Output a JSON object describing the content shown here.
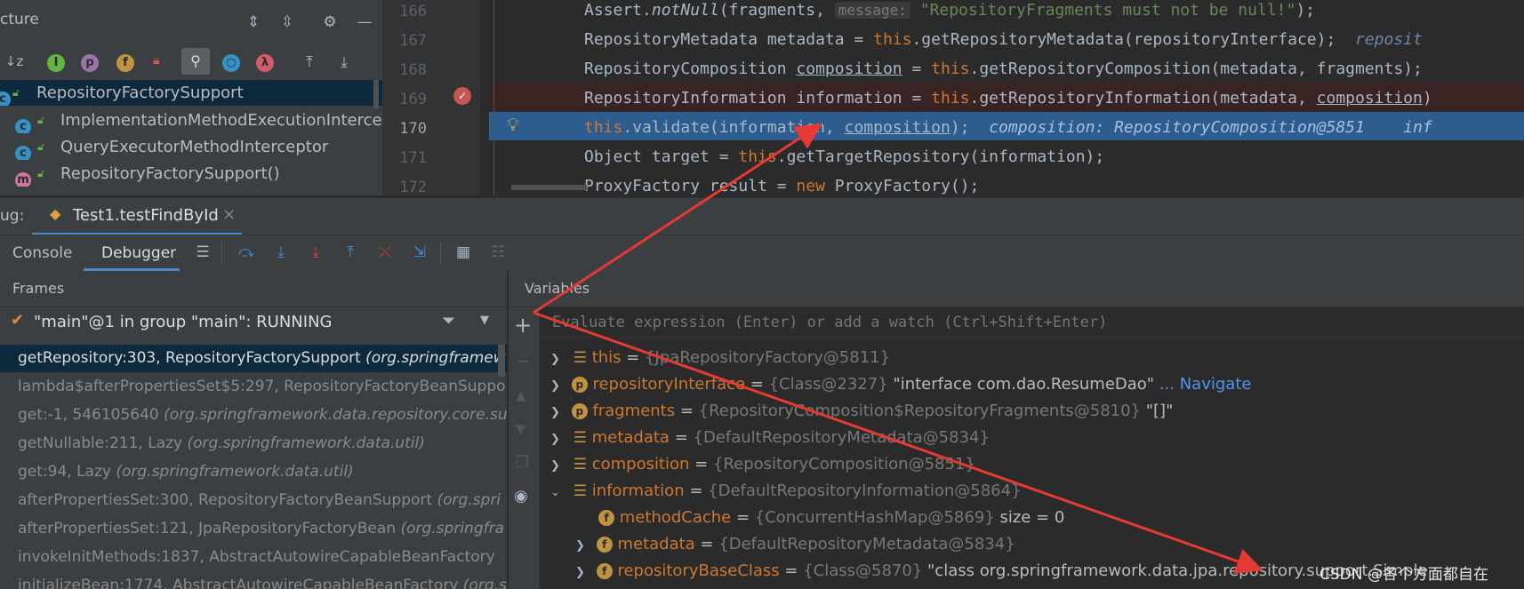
{
  "structure": {
    "title": "cture",
    "items": [
      {
        "label": "RepositoryFactorySupport",
        "icon": "class-icon",
        "selected": true
      },
      {
        "label": "ImplementationMethodExecutionIntercep",
        "icon": "class-icon"
      },
      {
        "label": "QueryExecutorMethodInterceptor",
        "icon": "class-icon"
      },
      {
        "label": "RepositoryFactorySupport()",
        "icon": "method-icon"
      }
    ]
  },
  "editor": {
    "lines": [
      {
        "num": "166"
      },
      {
        "num": "167"
      },
      {
        "num": "168"
      },
      {
        "num": "169"
      },
      {
        "num": "170"
      },
      {
        "num": "171"
      },
      {
        "num": "172"
      }
    ],
    "tokens": {
      "assert": "Assert.",
      "notnull": "notNull",
      "frag_open": "(fragments,",
      "message_hint": "message:",
      "message_str": "\"RepositoryFragments must not be null!\"",
      "close_semi": ");",
      "l167_a": "RepositoryMetadata metadata = ",
      "kw_this": "this",
      "l167_b": ".getRepositoryMetadata(repositoryInterface);",
      "l167_hint": "reposit",
      "l168_a": "RepositoryComposition ",
      "l168_var": "composition",
      "l168_b": " = ",
      "l168_c": ".getRepositoryComposition(metadata, fragments);",
      "l169_a": "RepositoryInformation information = ",
      "l169_b": ".getRepositoryInformation(metadata, ",
      "l169_var": "composition",
      "l169_c": ")",
      "l170_b": ".validate(information, ",
      "l170_var": "composition",
      "l170_c": ");",
      "l170_inline": "composition: RepositoryComposition@5851",
      "l170_inline2": "inf",
      "l171_a": "Object target = ",
      "l171_b": ".getTargetRepository(information);",
      "l172_a": "ProxyFactory result = ",
      "kw_new": "new",
      "l172_b": " ProxyFactory();"
    }
  },
  "debug": {
    "label": "ug:",
    "session_tab": "Test1.testFindById",
    "close": "×",
    "tabs": [
      "Console",
      "Debugger"
    ],
    "active_tab": "Debugger"
  },
  "frames": {
    "header": "Frames",
    "thread": "\"main\"@1 in group \"main\": RUNNING",
    "items": [
      {
        "loc": "getRepository:303, RepositoryFactorySupport ",
        "pkg": "(org.springframew",
        "selected": true
      },
      {
        "loc": "lambda$afterPropertiesSet$5:297, RepositoryFactoryBeanSuppo",
        "pkg": ""
      },
      {
        "loc": "get:-1, 546105640 ",
        "pkg": "(org.springframework.data.repository.core.su"
      },
      {
        "loc": "getNullable:211, Lazy ",
        "pkg": "(org.springframework.data.util)"
      },
      {
        "loc": "get:94, Lazy ",
        "pkg": "(org.springframework.data.util)"
      },
      {
        "loc": "afterPropertiesSet:300, RepositoryFactoryBeanSupport ",
        "pkg": "(org.spri"
      },
      {
        "loc": "afterPropertiesSet:121, JpaRepositoryFactoryBean ",
        "pkg": "(org.springfra"
      },
      {
        "loc": "invokeInitMethods:1837, AbstractAutowireCapableBeanFactory",
        "pkg": ""
      },
      {
        "loc": "initializeBean:1774, AbstractAutowireCapableBeanFactory ",
        "pkg": "(org.s"
      }
    ]
  },
  "variables": {
    "header": "Variables",
    "placeholder": "Evaluate expression (Enter) or add a watch (Ctrl+Shift+Enter)",
    "items": [
      {
        "name": "this",
        "ref": "{JpaRepositoryFactory@5811}",
        "val": ""
      },
      {
        "name": "repositoryInterface",
        "ref": "{Class@2327}",
        "val": "\"interface com.dao.ResumeDao\"",
        "link": "... Navigate"
      },
      {
        "name": "fragments",
        "ref": "{RepositoryComposition$RepositoryFragments@5810}",
        "val": "\"[]\""
      },
      {
        "name": "metadata",
        "ref": "{DefaultRepositoryMetadata@5834}",
        "val": ""
      },
      {
        "name": "composition",
        "ref": "{RepositoryComposition@5851}",
        "val": ""
      },
      {
        "name": "information",
        "ref": "{DefaultRepositoryInformation@5864}",
        "val": ""
      },
      {
        "name": "methodCache",
        "ref": "{ConcurrentHashMap@5869}",
        "val": " size = 0"
      },
      {
        "name": "metadata",
        "ref": "{DefaultRepositoryMetadata@5834}",
        "val": ""
      },
      {
        "name": "repositoryBaseClass",
        "ref": "{Class@5870}",
        "val": "\"class org.springframework.data.jpa.repository.support.Simple"
      }
    ],
    "eq": " = "
  },
  "watermark": "CSDN @各个方面都自在",
  "colors": {
    "selection": "#2d5c8f",
    "keyword": "#cc7832",
    "string": "#6a8759",
    "arrow": "#e53935"
  }
}
